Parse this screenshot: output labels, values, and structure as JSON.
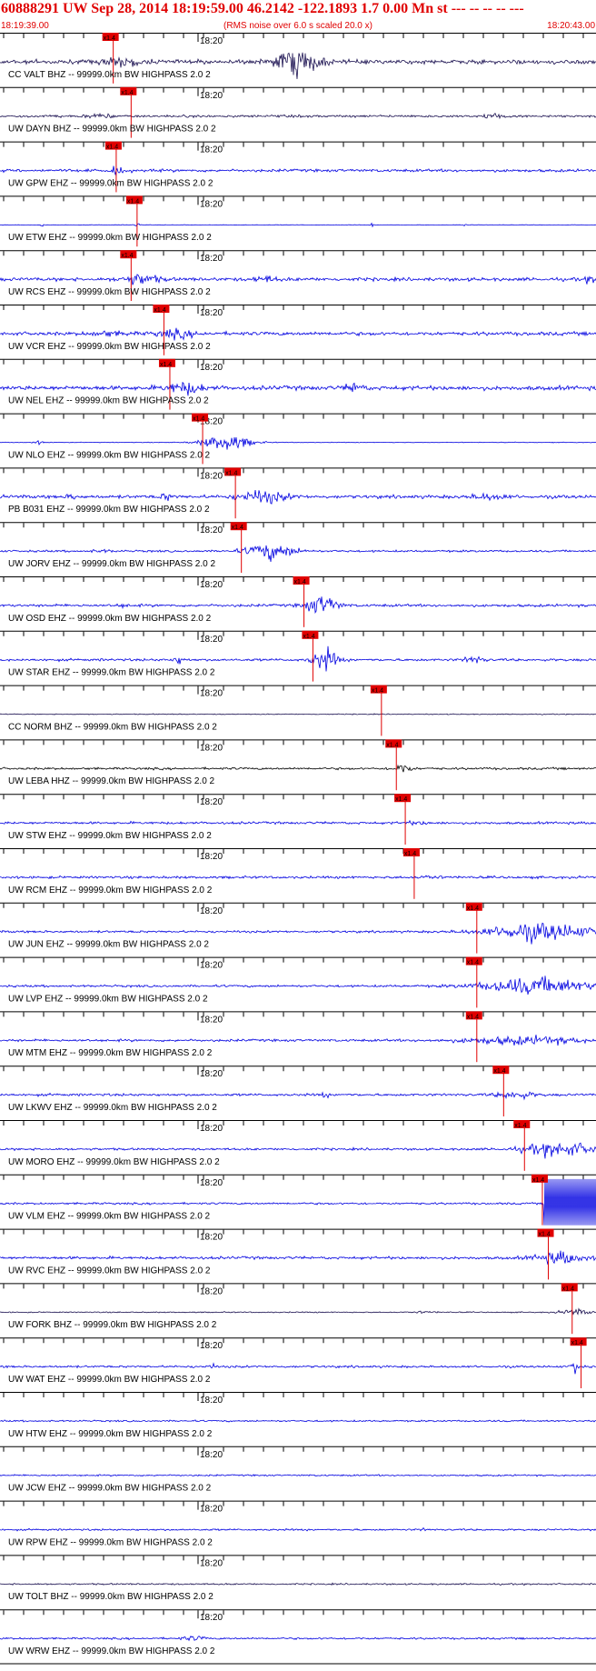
{
  "header": {
    "title": "60888291 UW Sep 28, 2014 18:19:59.00   46.2142 -122.1893  1.7 0.00 Mn st --- -- -- -- ---",
    "start_time": "18:19:39.00",
    "rms_note": "(RMS noise over 6.0 s scaled 20.0 x)",
    "end_time": "18:20:43.00"
  },
  "colors": {
    "title": "#e00000",
    "trace": "#0000e0",
    "trace_dark": "#1a1050",
    "trace_black": "#000000",
    "pick": "#e00000"
  },
  "chart_data": {
    "type": "line",
    "time_range": [
      "18:19:39.00",
      "18:20:43.00"
    ],
    "minute_tick_label": "18:20",
    "pick_label": "x1.4",
    "traces": [
      {
        "label": "CC VALT BHZ -- 99999.0km BW  HIGHPASS  2.0  2",
        "pick": 0.19,
        "amp": 0.38,
        "color": "dark",
        "bursts": [
          [
            0.205,
            3,
            0.03
          ],
          [
            0.5,
            7,
            0.035
          ]
        ]
      },
      {
        "label": "UW DAYN BHZ -- 99999.0km BW  HIGHPASS  2.0  2",
        "pick": 0.22,
        "amp": 0.22,
        "color": "dark",
        "bursts": [
          [
            0.165,
            2.5,
            0.02
          ],
          [
            0.83,
            3,
            0.015
          ]
        ]
      },
      {
        "label": "UW GPW EHZ -- 99999.0km BW  HIGHPASS  2.0  2",
        "pick": 0.195,
        "amp": 0.25,
        "color": "blue",
        "bursts": [
          [
            0.2,
            4,
            0.012
          ]
        ]
      },
      {
        "label": "UW ETW EHZ -- 99999.0km BW  HIGHPASS  2.0  2",
        "pick": 0.23,
        "amp": 0.05,
        "color": "blue",
        "bursts": [
          [
            0.07,
            15,
            0.002
          ],
          [
            0.23,
            12,
            0.004
          ],
          [
            0.625,
            15,
            0.002
          ],
          [
            0.78,
            12,
            0.002
          ]
        ]
      },
      {
        "label": "UW RCS EHZ -- 99999.0km BW  HIGHPASS  2.0  2",
        "pick": 0.22,
        "amp": 0.3,
        "color": "blue",
        "bursts": [
          [
            0.235,
            4,
            0.03
          ],
          [
            0.445,
            2.5,
            0.02
          ],
          [
            0.99,
            2.5,
            0.01
          ]
        ]
      },
      {
        "label": "UW VCR EHZ -- 99999.0km BW  HIGHPASS  2.0  2",
        "pick": 0.275,
        "amp": 0.32,
        "color": "blue",
        "bursts": [
          [
            0.18,
            2,
            0.03
          ],
          [
            0.295,
            3,
            0.03
          ]
        ]
      },
      {
        "label": "UW NEL EHZ -- 99999.0km BW  HIGHPASS  2.0  2",
        "pick": 0.285,
        "amp": 0.38,
        "color": "blue",
        "bursts": [
          [
            0.31,
            3.5,
            0.03
          ],
          [
            0.595,
            3,
            0.015
          ]
        ]
      },
      {
        "label": "UW NLO EHZ -- 99999.0km BW  HIGHPASS  2.0  2",
        "pick": 0.34,
        "amp": 0.06,
        "color": "blue",
        "bursts": [
          [
            0.065,
            6,
            0.01
          ],
          [
            0.38,
            25,
            0.04
          ]
        ]
      },
      {
        "label": "PB B031 EHZ -- 99999.0km BW  HIGHPASS  2.0  2",
        "pick": 0.395,
        "amp": 0.3,
        "color": "blue",
        "bursts": [
          [
            0.12,
            3,
            0.006
          ],
          [
            0.28,
            3,
            0.01
          ],
          [
            0.44,
            4.5,
            0.04
          ],
          [
            0.82,
            2.5,
            0.03
          ]
        ]
      },
      {
        "label": "UW JORV EHZ -- 99999.0km BW  HIGHPASS  2.0  2",
        "pick": 0.405,
        "amp": 0.18,
        "color": "blue",
        "bursts": [
          [
            0.17,
            2,
            0.02
          ],
          [
            0.455,
            9,
            0.04
          ]
        ]
      },
      {
        "label": "UW OSD EHZ -- 99999.0km BW  HIGHPASS  2.0  2",
        "pick": 0.51,
        "amp": 0.24,
        "color": "blue",
        "bursts": [
          [
            0.205,
            2,
            0.01
          ],
          [
            0.54,
            8,
            0.025
          ]
        ]
      },
      {
        "label": "UW STAR EHZ -- 99999.0km BW  HIGHPASS  2.0  2",
        "pick": 0.525,
        "amp": 0.22,
        "color": "blue",
        "bursts": [
          [
            0.3,
            4,
            0.01
          ],
          [
            0.545,
            10,
            0.02
          ],
          [
            0.795,
            4,
            0.015
          ]
        ]
      },
      {
        "label": "CC NORM BHZ -- 99999.0km BW  HIGHPASS  2.0  2",
        "pick": 0.64,
        "amp": 0.08,
        "color": "dark",
        "bursts": []
      },
      {
        "label": "UW LEBA HHZ -- 99999.0km BW  HIGHPASS  2.0  2",
        "pick": 0.665,
        "amp": 0.2,
        "color": "black",
        "bursts": [
          [
            0.675,
            5,
            0.015
          ]
        ]
      },
      {
        "label": "UW STW EHZ -- 99999.0km BW  HIGHPASS  2.0  2",
        "pick": 0.68,
        "amp": 0.22,
        "color": "blue",
        "bursts": [
          [
            0.7,
            2,
            0.02
          ]
        ]
      },
      {
        "label": "UW RCM EHZ -- 99999.0km BW  HIGHPASS  2.0  2",
        "pick": 0.695,
        "amp": 0.22,
        "color": "blue",
        "bursts": [
          [
            0.72,
            2,
            0.02
          ]
        ]
      },
      {
        "label": "UW JUN EHZ -- 99999.0km BW  HIGHPASS  2.0  2",
        "pick": 0.8,
        "amp": 0.2,
        "color": "blue",
        "bursts": [
          [
            0.905,
            9,
            0.085
          ]
        ]
      },
      {
        "label": "UW LVP EHZ -- 99999.0km BW  HIGHPASS  2.0  2",
        "pick": 0.8,
        "amp": 0.2,
        "color": "blue",
        "bursts": [
          [
            0.9,
            8,
            0.09
          ]
        ]
      },
      {
        "label": "UW MTM EHZ -- 99999.0km BW  HIGHPASS  2.0  2",
        "pick": 0.8,
        "amp": 0.22,
        "color": "blue",
        "bursts": [
          [
            0.88,
            4,
            0.1
          ]
        ]
      },
      {
        "label": "UW LKWV EHZ -- 99999.0km BW  HIGHPASS  2.0  2",
        "pick": 0.845,
        "amp": 0.22,
        "color": "blue",
        "bursts": [
          [
            0.545,
            3,
            0.006
          ],
          [
            0.865,
            4,
            0.03
          ]
        ]
      },
      {
        "label": "UW MORO EHZ -- 99999.0km BW  HIGHPASS  2.0  2",
        "pick": 0.88,
        "amp": 0.2,
        "color": "blue",
        "bursts": [
          [
            0.94,
            7,
            0.06
          ]
        ]
      },
      {
        "label": "UW VLM EHZ -- 99999.0km BW  HIGHPASS  2.0  2",
        "pick": 0.91,
        "amp": 0.18,
        "color": "blue",
        "bursts": [],
        "clip": 0.912
      },
      {
        "label": "UW RVC EHZ -- 99999.0km BW  HIGHPASS  2.0  2",
        "pick": 0.92,
        "amp": 0.25,
        "color": "blue",
        "bursts": [
          [
            0.94,
            5,
            0.04
          ]
        ]
      },
      {
        "label": "UW FORK BHZ -- 99999.0km BW  HIGHPASS  2.0  2",
        "pick": 0.96,
        "amp": 0.1,
        "color": "dark",
        "bursts": [
          [
            0.71,
            2.5,
            0.02
          ],
          [
            0.965,
            6,
            0.025
          ]
        ]
      },
      {
        "label": "UW WAT EHZ -- 99999.0km BW  HIGHPASS  2.0  2",
        "pick": 0.975,
        "amp": 0.2,
        "color": "blue",
        "bursts": [
          [
            0.355,
            5,
            0.004
          ],
          [
            0.965,
            10,
            0.005
          ]
        ]
      },
      {
        "label": "UW HTW EHZ -- 99999.0km BW  HIGHPASS  2.0  2",
        "amp": 0.15,
        "color": "blue",
        "bursts": []
      },
      {
        "label": "UW JCW EHZ -- 99999.0km BW  HIGHPASS  2.0  2",
        "amp": 0.14,
        "color": "blue",
        "bursts": []
      },
      {
        "label": "UW RPW EHZ -- 99999.0km BW  HIGHPASS  2.0  2",
        "amp": 0.16,
        "color": "blue",
        "bursts": [
          [
            0.71,
            2,
            0.01
          ]
        ]
      },
      {
        "label": "UW TOLT BHZ -- 99999.0km BW  HIGHPASS  2.0  2",
        "amp": 0.14,
        "color": "dark",
        "bursts": []
      },
      {
        "label": "UW WRW EHZ -- 99999.0km BW  HIGHPASS  2.0  2",
        "amp": 0.17,
        "color": "blue",
        "bursts": [
          [
            0.325,
            3,
            0.02
          ]
        ]
      }
    ]
  }
}
